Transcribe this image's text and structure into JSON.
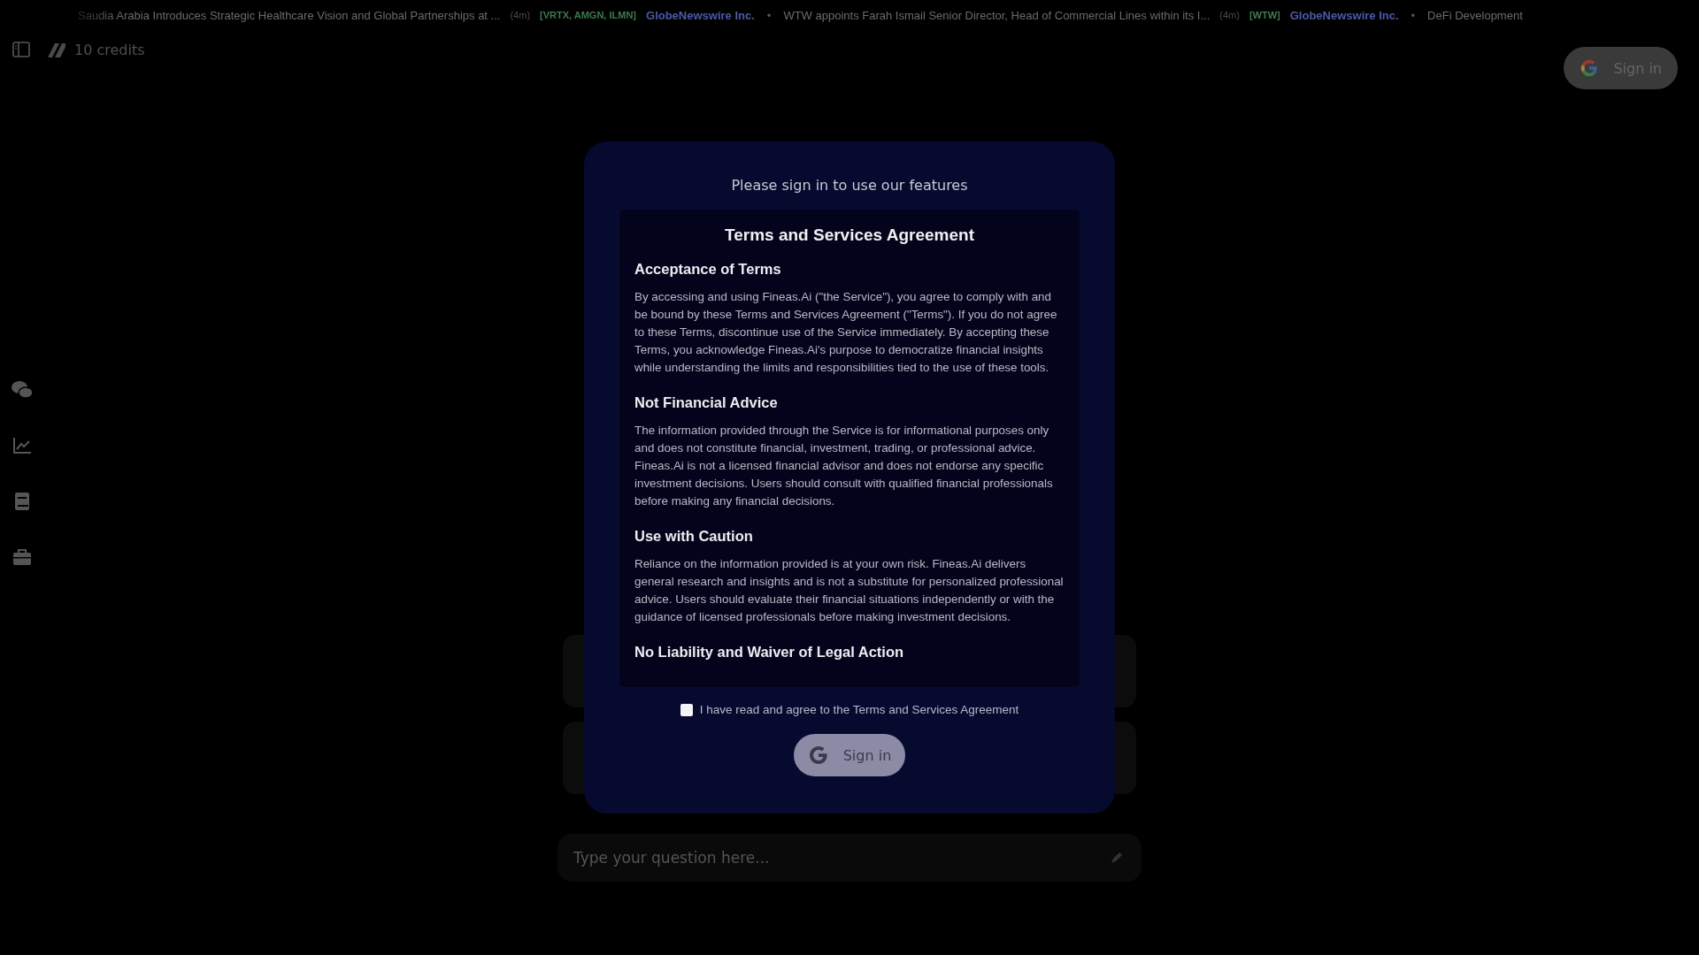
{
  "ticker": [
    {
      "headline": "Saudia Arabia Introduces Strategic Healthcare Vision and Global Partnerships at ...",
      "age": "(4m)",
      "symbols": "[VRTX, AMGN, ILMN]",
      "source": "GlobeNewswire Inc."
    },
    {
      "separator": "•",
      "headline": "WTW appoints Farah Ismail Senior Director, Head of Commercial Lines within its I...",
      "age": "(4m)",
      "symbols": "[WTW]",
      "source": "GlobeNewswire Inc."
    },
    {
      "separator": "•",
      "headline": "DeFi Development"
    }
  ],
  "credits": "10 credits",
  "header_sign_in": "Sign in",
  "nav": [
    {
      "kind": "chat"
    },
    {
      "kind": "chart"
    },
    {
      "kind": "book"
    },
    {
      "kind": "briefcase"
    }
  ],
  "question": {
    "placeholder": "Type your question here..."
  },
  "modal": {
    "prompt": "Please sign in to use our features",
    "terms": {
      "title": "Terms and Services Agreement",
      "sections": [
        {
          "heading": "Acceptance of Terms",
          "body": "By accessing and using Fineas.Ai (\"the Service\"), you agree to comply with and be bound by these Terms and Services Agreement (\"Terms\"). If you do not agree to these Terms, discontinue use of the Service immediately. By accepting these Terms, you acknowledge Fineas.Ai's purpose to democratize financial insights while understanding the limits and responsibilities tied to the use of these tools."
        },
        {
          "heading": "Not Financial Advice",
          "body": "The information provided through the Service is for informational purposes only and does not constitute financial, investment, trading, or professional advice. Fineas.Ai is not a licensed financial advisor and does not endorse any specific investment decisions. Users should consult with qualified financial professionals before making any financial decisions."
        },
        {
          "heading": "Use with Caution",
          "body": "Reliance on the information provided is at your own risk. Fineas.Ai delivers general research and insights and is not a substitute for personalized professional advice. Users should evaluate their financial situations independently or with the guidance of licensed professionals before making investment decisions."
        },
        {
          "heading": "No Liability and Waiver of Legal Action"
        }
      ]
    },
    "agree": {
      "label": "I have read and agree to the Terms and Services Agreement",
      "checked": false
    },
    "sign_in": "Sign in"
  }
}
